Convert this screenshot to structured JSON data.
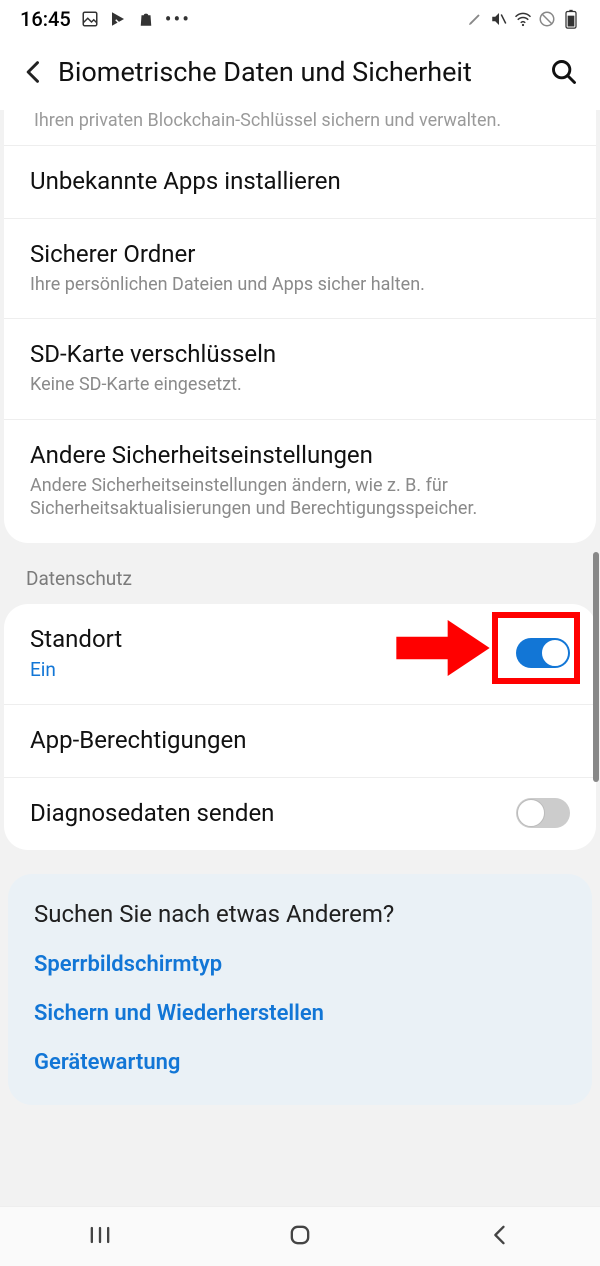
{
  "status": {
    "time": "16:45"
  },
  "header": {
    "title": "Biometrische Daten und Sicherheit"
  },
  "cut_text": "Ihren privaten Blockchain-Schlüssel sichern und verwalten.",
  "security_rows": [
    {
      "title": "Unbekannte Apps installieren",
      "sub": ""
    },
    {
      "title": "Sicherer Ordner",
      "sub": "Ihre persönlichen Dateien und Apps sicher halten."
    },
    {
      "title": "SD-Karte verschlüsseln",
      "sub": "Keine SD-Karte eingesetzt."
    },
    {
      "title": "Andere Sicherheitseinstellungen",
      "sub": "Andere Sicherheitseinstellungen ändern, wie z. B. für Sicherheitsaktualisierungen und Berechtigungsspeicher."
    }
  ],
  "privacy_section_label": "Datenschutz",
  "privacy_rows": {
    "location": {
      "title": "Standort",
      "status": "Ein"
    },
    "app_perm": {
      "title": "App-Berechtigungen"
    },
    "diag": {
      "title": "Diagnosedaten senden"
    }
  },
  "suggestions": {
    "title": "Suchen Sie nach etwas Anderem?",
    "links": [
      "Sperrbildschirmtyp",
      "Sichern und Wiederherstellen",
      "Gerätewartung"
    ]
  }
}
